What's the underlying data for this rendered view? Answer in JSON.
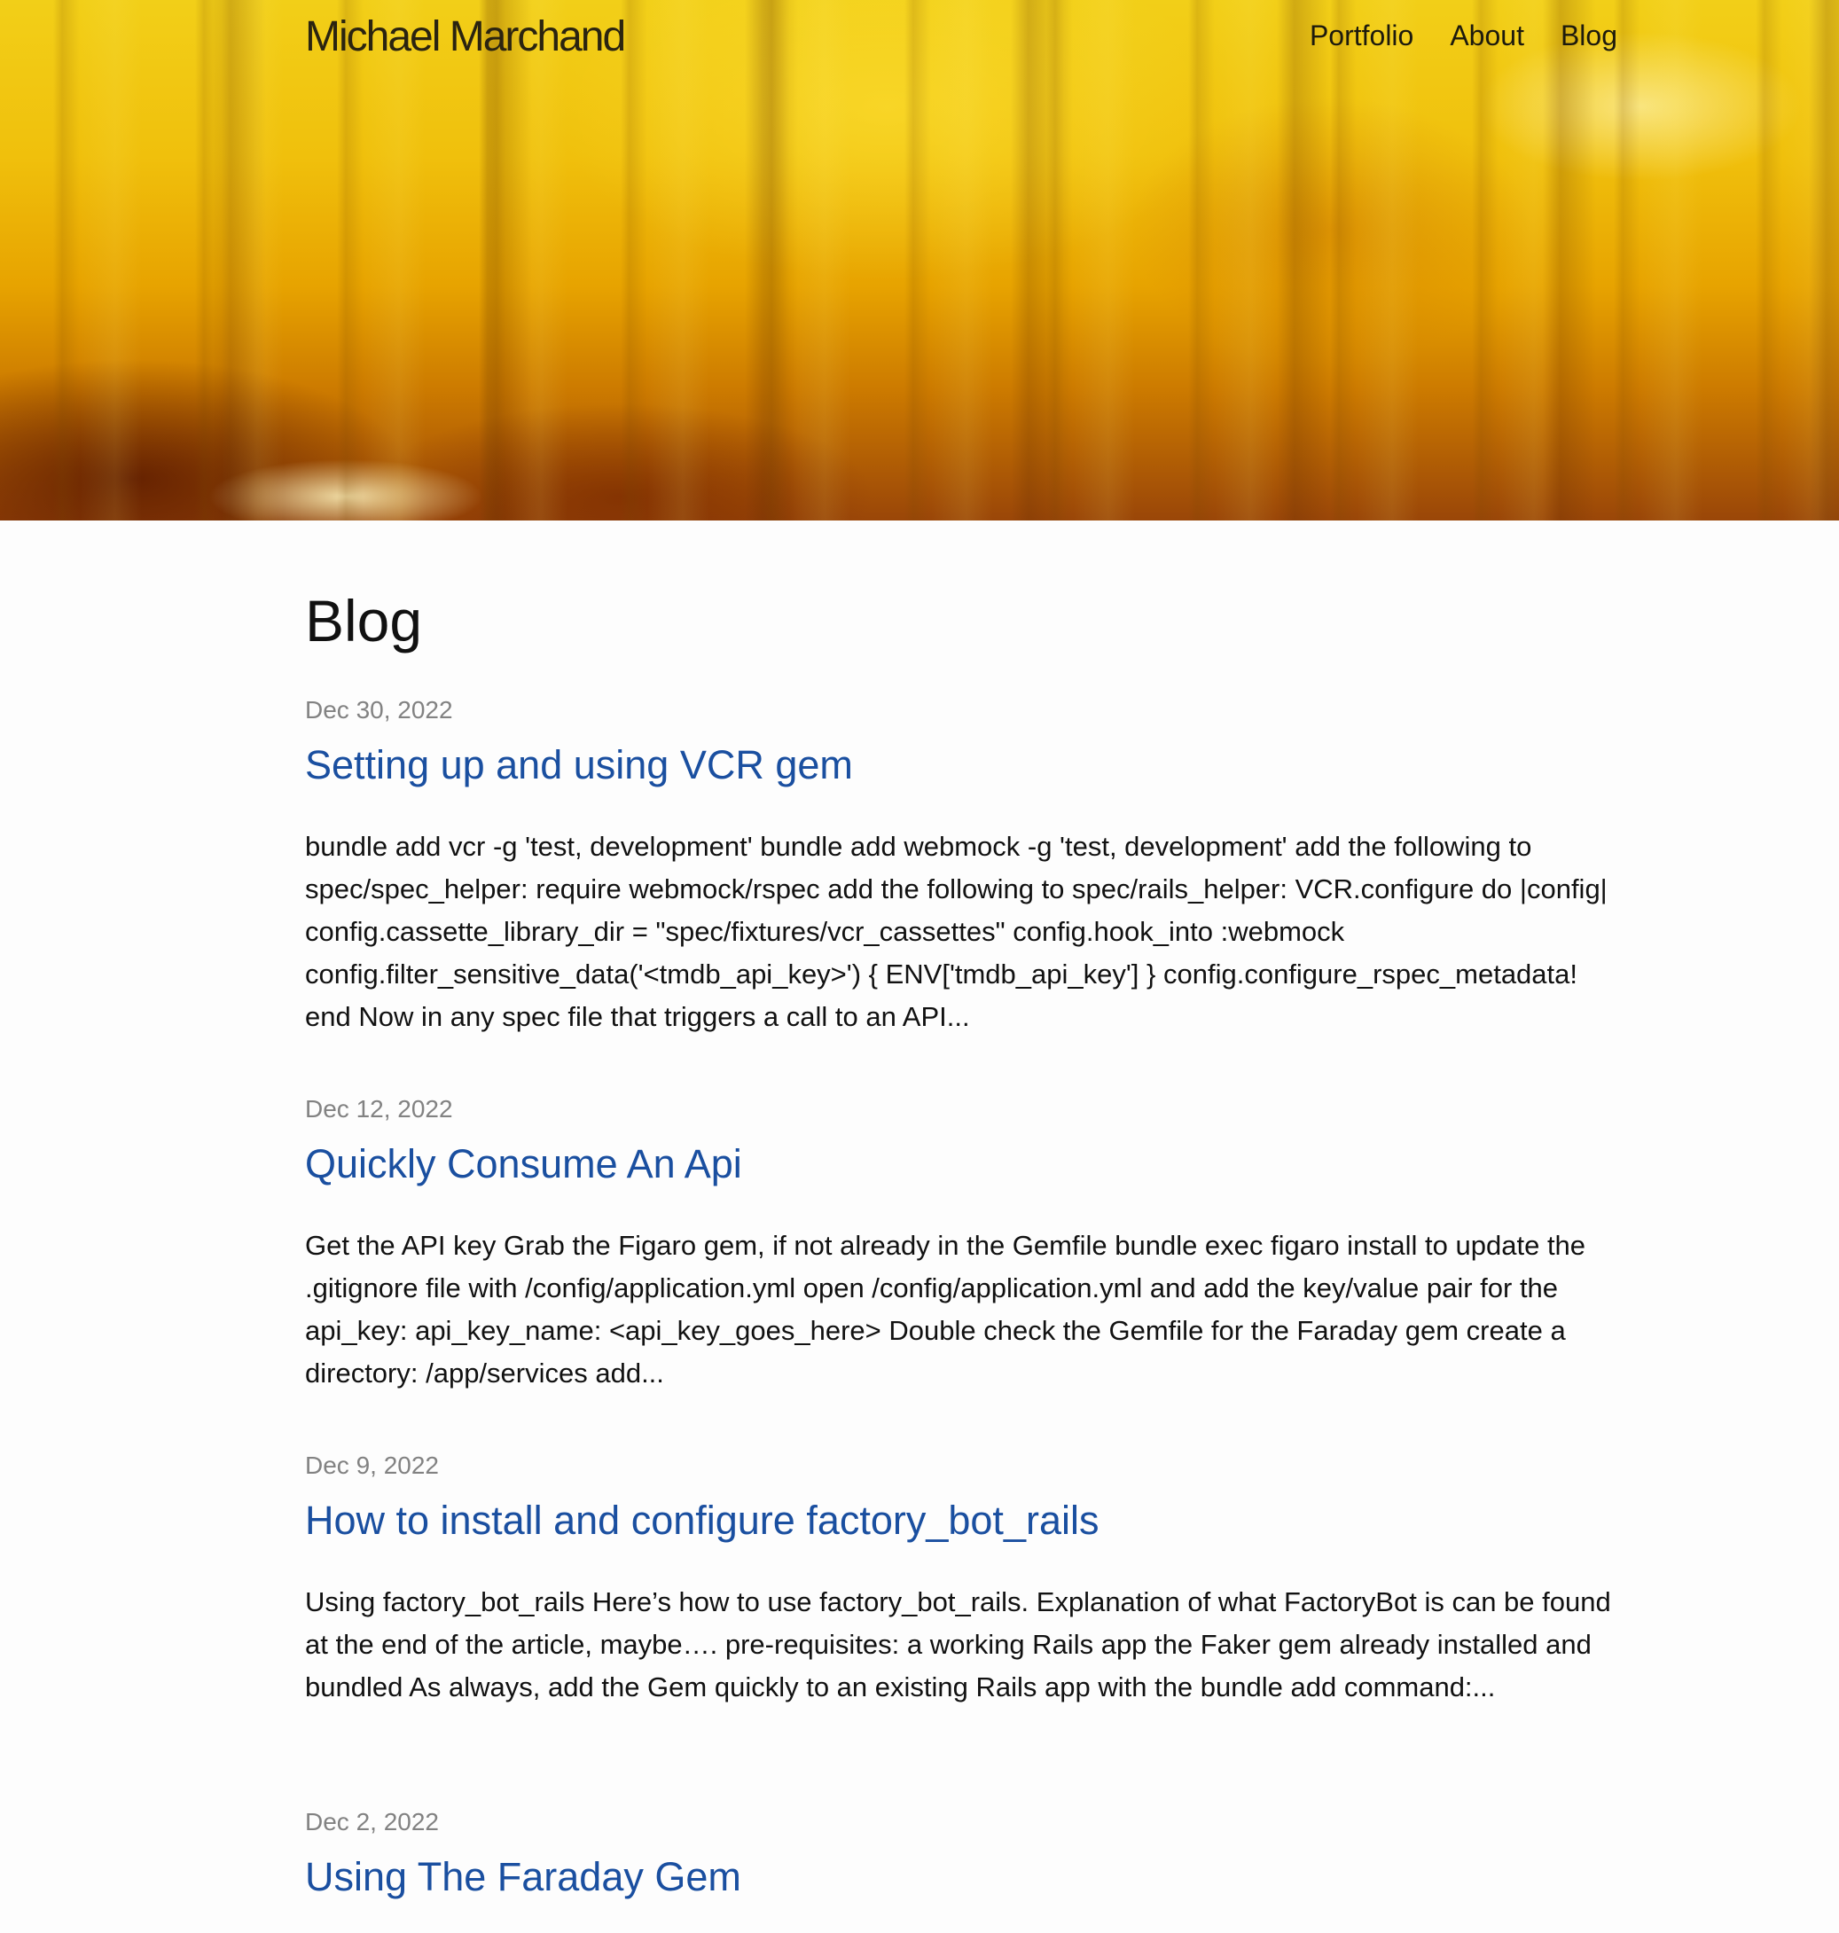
{
  "site": {
    "title": "Michael Marchand"
  },
  "nav": {
    "items": [
      {
        "label": "Portfolio"
      },
      {
        "label": "About"
      },
      {
        "label": "Blog"
      }
    ]
  },
  "hero": {
    "icon": "yellow-abstract-photo"
  },
  "main": {
    "page_title": "Blog",
    "posts": [
      {
        "date": "Dec 30, 2022",
        "title": "Setting up and using VCR gem",
        "excerpt": "bundle add vcr -g 'test, development' bundle add webmock -g 'test, development' add the following to spec/spec_helper: require webmock/rspec add the following to spec/rails_helper: VCR.configure do |config| config.cassette_library_dir = \"spec/fixtures/vcr_cassettes\" config.hook_into :webmock config.filter_sensitive_data('<tmdb_api_key>') { ENV['tmdb_api_key'] } config.configure_rspec_metadata! end Now in any spec file that triggers a call to an API..."
      },
      {
        "date": "Dec 12, 2022",
        "title": "Quickly Consume An Api",
        "excerpt": "Get the API key Grab the Figaro gem, if not already in the Gemfile bundle exec figaro install to update the .gitignore file with /config/application.yml open /config/application.yml and add the key/value pair for the api_key: api_key_name: <api_key_goes_here> Double check the Gemfile for the Faraday gem create a directory: /app/services add..."
      },
      {
        "date": "Dec 9, 2022",
        "title": "How to install and configure factory_bot_rails",
        "excerpt": "Using factory_bot_rails Here’s how to use factory_bot_rails. Explanation of what FactoryBot is can be found at the end of the article, maybe…. pre-requisites: a working Rails app the Faker gem already installed and bundled As always, add the Gem quickly to an existing Rails app with the bundle add command:..."
      },
      {
        "date": "Dec 2, 2022",
        "title": "Using The Faraday Gem"
      }
    ]
  },
  "colors": {
    "link": "#1a4fa0",
    "date": "#828282",
    "text": "#111111",
    "hero_yellow": "#f0c00c"
  }
}
